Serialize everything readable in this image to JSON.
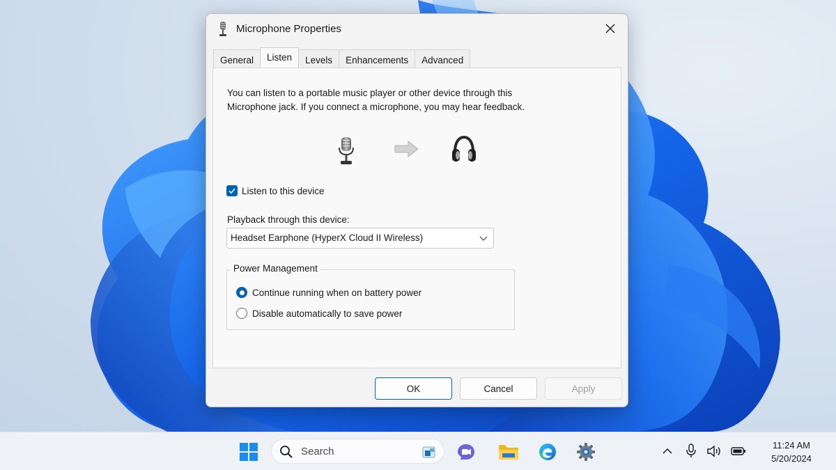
{
  "dialog": {
    "title": "Microphone Properties",
    "tabs": [
      {
        "label": "General",
        "active": false
      },
      {
        "label": "Listen",
        "active": true
      },
      {
        "label": "Levels",
        "active": false
      },
      {
        "label": "Enhancements",
        "active": false
      },
      {
        "label": "Advanced",
        "active": false
      }
    ],
    "description_line1": "You can listen to a portable music player or other device through this",
    "description_line2": "Microphone jack.  If you connect a microphone, you may hear feedback.",
    "listen_checkbox": {
      "label": "Listen to this device",
      "checked": true
    },
    "playback_label": "Playback through this device:",
    "playback_device": "Headset Earphone (HyperX Cloud II Wireless)",
    "power_management": {
      "legend": "Power Management",
      "options": [
        {
          "label": "Continue running when on battery power",
          "selected": true
        },
        {
          "label": "Disable automatically to save power",
          "selected": false
        }
      ]
    },
    "buttons": {
      "ok": "OK",
      "cancel": "Cancel",
      "apply": "Apply"
    },
    "accent_color": "#0063b1"
  },
  "taskbar": {
    "search_placeholder": "Search",
    "apps": [
      "windows-start-icon",
      "teams-chat-icon",
      "file-explorer-icon",
      "edge-browser-icon",
      "settings-gear-icon"
    ],
    "tray_icons": [
      "chevron-up-icon",
      "microphone-icon",
      "speaker-icon",
      "battery-icon"
    ],
    "time": "11:24 AM",
    "date": "5/20/2024"
  }
}
